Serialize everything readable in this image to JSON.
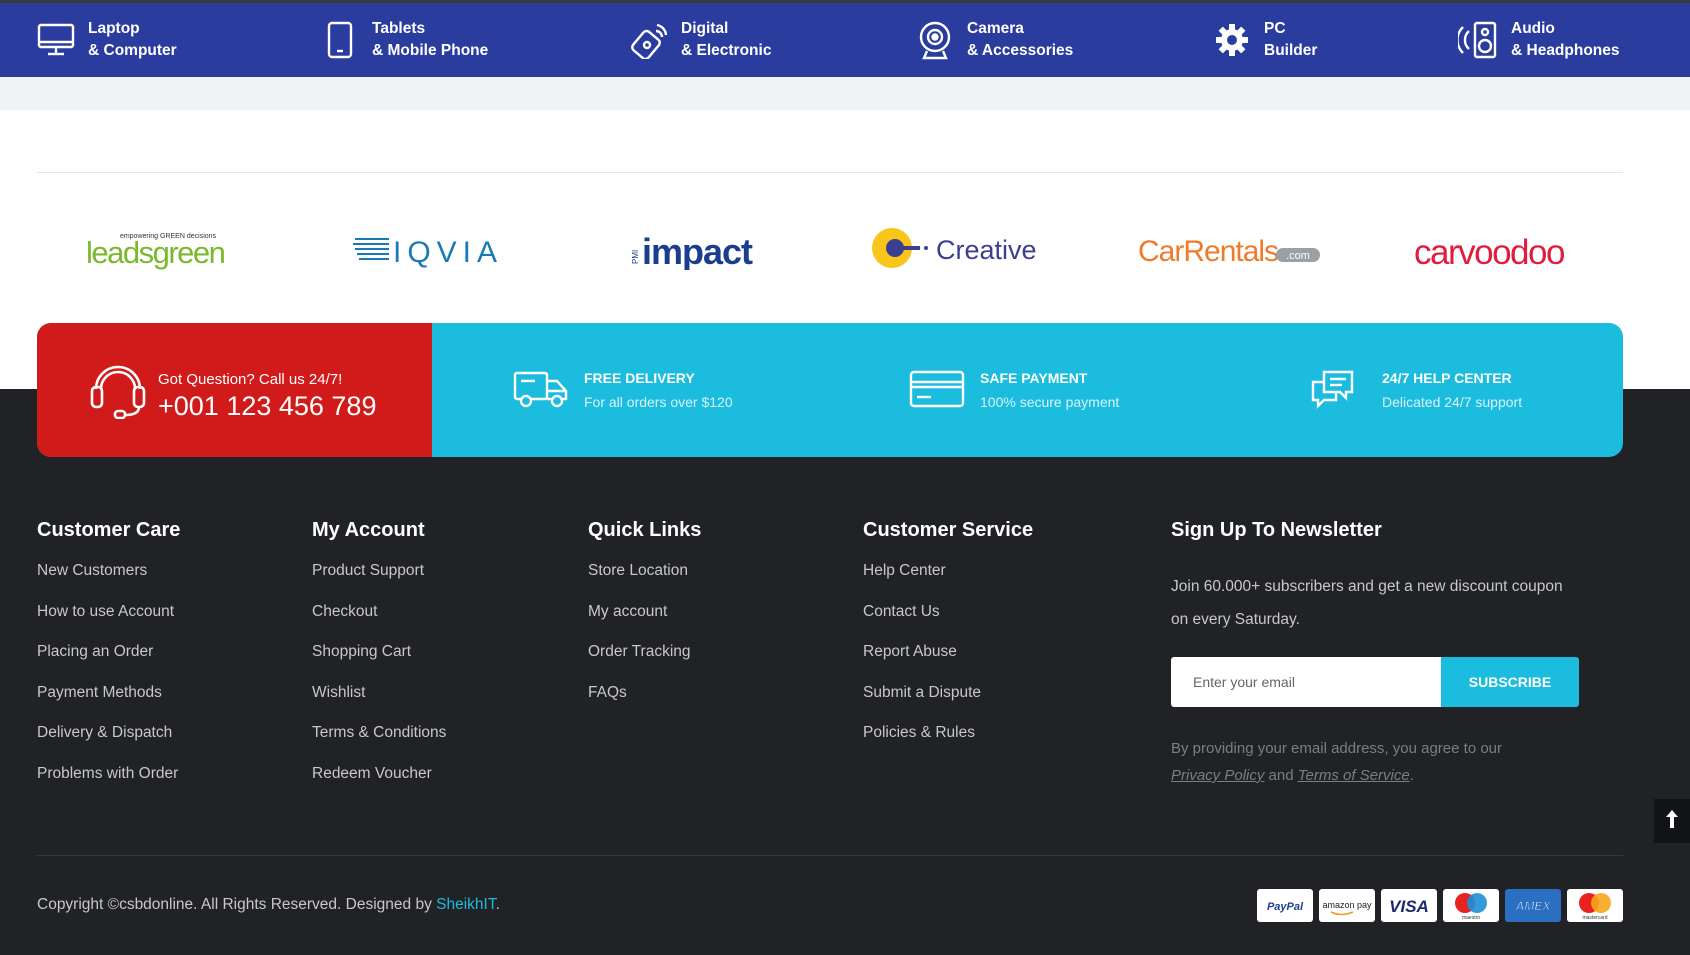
{
  "categories": [
    {
      "line1": "Laptop",
      "line2": "& Computer",
      "icon": "monitor-icon"
    },
    {
      "line1": "Tablets",
      "line2": "& Mobile Phone",
      "icon": "mobile-phone-icon"
    },
    {
      "line1": "Digital",
      "line2": "& Electronic",
      "icon": "electronic-device-icon"
    },
    {
      "line1": "Camera",
      "line2": "& Accessories",
      "icon": "webcam-icon"
    },
    {
      "line1": "PC",
      "line2": "Builder",
      "icon": "gear-icon"
    },
    {
      "line1": "Audio",
      "line2": "& Headphones",
      "icon": "speaker-icon"
    }
  ],
  "brands": [
    {
      "name": "leadsgreen",
      "tagline": "empowering GREEN decisions",
      "color": "#7ab92b"
    },
    {
      "name": "IQVIA",
      "color": "#1a7ab8"
    },
    {
      "name": "impact",
      "prefix": "PMI",
      "color": "#1c3d8f"
    },
    {
      "name": "Creative",
      "color": "#3b3f8f"
    },
    {
      "name": "CarRentals",
      "suffix": ".com",
      "color": "#f07a2a"
    },
    {
      "name": "carvoodoo",
      "color": "#e11d3f"
    }
  ],
  "call": {
    "question": "Got Question? Call us 24/7!",
    "phone": "+001 123 456 789"
  },
  "features": [
    {
      "title": "FREE DELIVERY",
      "subtitle": "For all orders over $120",
      "icon": "truck-icon"
    },
    {
      "title": "SAFE PAYMENT",
      "subtitle": "100% secure payment",
      "icon": "credit-card-icon"
    },
    {
      "title": "24/7 HELP CENTER",
      "subtitle": "Delicated 24/7 support",
      "icon": "chat-bubbles-icon"
    }
  ],
  "columns": [
    {
      "title": "Customer Care",
      "links": [
        "New Customers",
        "How to use Account",
        "Placing an Order",
        "Payment Methods",
        "Delivery & Dispatch",
        "Problems with Order"
      ]
    },
    {
      "title": "My Account",
      "links": [
        "Product Support",
        "Checkout",
        "Shopping Cart",
        "Wishlist",
        "Terms & Conditions",
        "Redeem Voucher"
      ]
    },
    {
      "title": "Quick Links",
      "links": [
        "Store Location",
        "My account",
        "Order Tracking",
        "FAQs"
      ]
    },
    {
      "title": "Customer Service",
      "links": [
        "Help Center",
        "Contact Us",
        "Report Abuse",
        "Submit a Dispute",
        "Policies & Rules"
      ]
    }
  ],
  "newsletter": {
    "title": "Sign Up To Newsletter",
    "desc": "Join 60.000+ subscribers and get a new discount coupon on every Saturday.",
    "placeholder": "Enter your email",
    "button": "SUBSCRIBE",
    "agree_prefix": "By providing your email address, you agree to our",
    "privacy": "Privacy Policy",
    "and": "and",
    "terms": "Terms of Service",
    "period": "."
  },
  "copyright": {
    "text": "Copyright ©csbdonline. All Rights Reserved. Designed by",
    "link": "SheikhIT",
    "period": "."
  },
  "payments": [
    "PayPal",
    "amazon pay",
    "VISA",
    "maestro",
    "AMEX",
    "mastercard"
  ],
  "colors": {
    "nav": "#2a3d9e",
    "accent": "#1bbcde",
    "call": "#d11b1b",
    "footer": "#212226"
  }
}
